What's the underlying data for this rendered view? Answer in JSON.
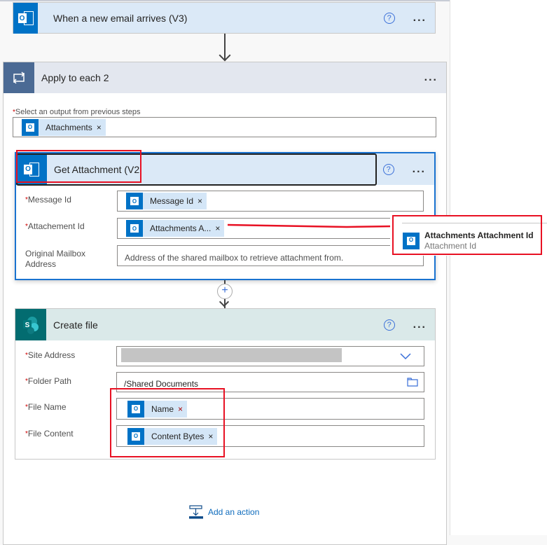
{
  "trigger": {
    "title": "When a new email arrives (V3)",
    "icon": "outlook-icon",
    "help": "?",
    "more": "..."
  },
  "loop": {
    "title": "Apply to each 2",
    "icon": "loop-icon",
    "more": "...",
    "output_label": "Select an output from previous steps",
    "output_token": "Attachments"
  },
  "get_attachment": {
    "title": "Get Attachment (V2",
    "help": "?",
    "more": "...",
    "fields": [
      {
        "label": "Message Id",
        "required": true,
        "token": "Message Id"
      },
      {
        "label": "Attachement Id",
        "required": true,
        "token": "Attachments A..."
      },
      {
        "label": "Original Mailbox Address",
        "required": false,
        "placeholder": "Address of the shared mailbox to retrieve attachment from."
      }
    ]
  },
  "popup": {
    "title": "Attachments Attachment Id",
    "subtitle": "Attachment Id"
  },
  "create_file": {
    "title": "Create file",
    "icon": "sharepoint-icon",
    "help": "?",
    "more": "...",
    "fields": [
      {
        "label": "Site Address",
        "required": true
      },
      {
        "label": "Folder Path",
        "required": true,
        "value": "/Shared Documents"
      },
      {
        "label": "File Name",
        "required": true,
        "token": "Name"
      },
      {
        "label": "File Content",
        "required": true,
        "token": "Content Bytes"
      }
    ]
  },
  "add_action": "Add an action",
  "colors": {
    "outlook": "#0072c6",
    "sharepoint": "#036c70",
    "loop": "#4b6a94",
    "highlight": "#e81123",
    "link": "#0f6cbd"
  }
}
